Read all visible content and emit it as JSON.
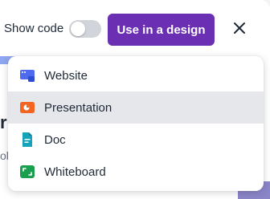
{
  "toolbar": {
    "show_code_label": "Show code",
    "show_code_enabled": false,
    "use_in_design_label": "Use in a design",
    "close_icon": "close-icon"
  },
  "menu": {
    "items": [
      {
        "label": "Website",
        "icon": "website-icon",
        "color": "#4f6bed"
      },
      {
        "label": "Presentation",
        "icon": "presentation-icon",
        "color": "#f26522",
        "highlighted": true
      },
      {
        "label": "Doc",
        "icon": "doc-icon",
        "color": "#14a3b8"
      },
      {
        "label": "Whiteboard",
        "icon": "whiteboard-icon",
        "color": "#1a9e4f"
      }
    ]
  },
  "background": {
    "text_fragment": "r",
    "text_fragment_2": "ol"
  },
  "colors": {
    "primary": "#6b2fb3",
    "toggle_off": "#d1d5db",
    "menu_highlight": "#e5e7eb"
  }
}
